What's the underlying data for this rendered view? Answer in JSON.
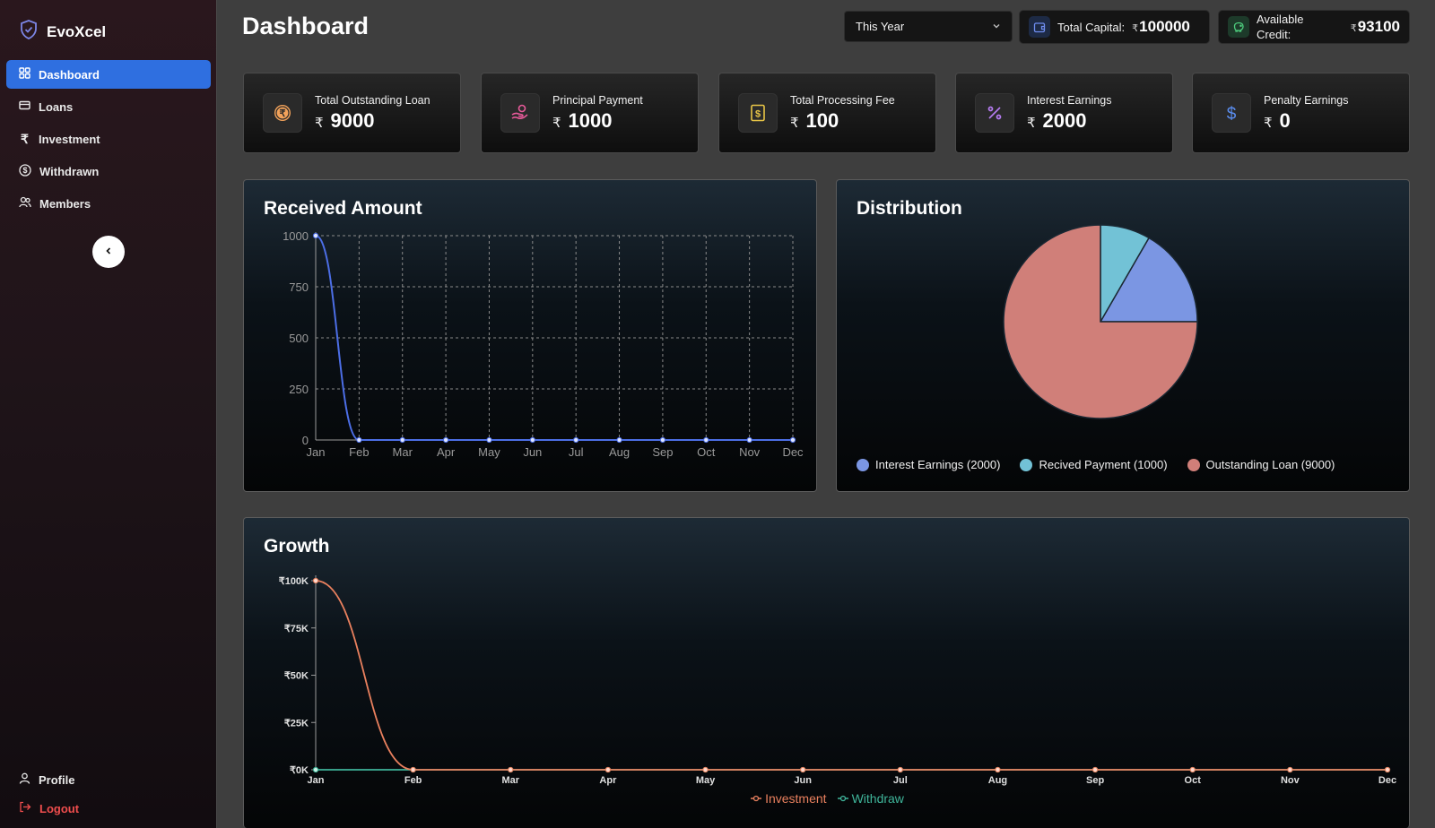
{
  "app": {
    "name": "EvoXcel"
  },
  "sidebar": {
    "items": [
      {
        "label": "Dashboard",
        "icon": "dashboard-grid-icon"
      },
      {
        "label": "Loans",
        "icon": "card-icon"
      },
      {
        "label": "Investment",
        "icon": "rupee-icon"
      },
      {
        "label": "Withdrawn",
        "icon": "dollar-circle-icon"
      },
      {
        "label": "Members",
        "icon": "users-icon"
      }
    ],
    "bottom": [
      {
        "label": "Profile",
        "icon": "user-icon"
      },
      {
        "label": "Logout",
        "icon": "logout-icon"
      }
    ]
  },
  "header": {
    "title": "Dashboard",
    "period": "This Year",
    "total_capital_label": "Total Capital:",
    "total_capital_currency": "₹",
    "total_capital_value": "100000",
    "available_credit_label": "Available Credit:",
    "available_credit_currency": "₹",
    "available_credit_value": "93100"
  },
  "stats": [
    {
      "label": "Total Outstanding Loan",
      "currency": "₹",
      "value": "9000",
      "icon": "rupee-coin-icon"
    },
    {
      "label": "Principal Payment",
      "currency": "₹",
      "value": "1000",
      "icon": "hand-coin-icon"
    },
    {
      "label": "Total Processing Fee",
      "currency": "₹",
      "value": "100",
      "icon": "dollar-bill-icon"
    },
    {
      "label": "Interest Earnings",
      "currency": "₹",
      "value": "2000",
      "icon": "percent-icon"
    },
    {
      "label": "Penalty Earnings",
      "currency": "₹",
      "value": "0",
      "icon": "dollar-icon"
    }
  ],
  "panels": {
    "received_title": "Received Amount",
    "distribution_title": "Distribution",
    "growth_title": "Growth"
  },
  "colors": {
    "accent": "#2f6fe0",
    "received_line": "#4c6ee6",
    "investment": "#e9805e",
    "withdraw": "#3fb59a",
    "pie_interest": "#7b96e3",
    "pie_received": "#72c2d6",
    "pie_outstanding": "#d07f79"
  },
  "chart_data": [
    {
      "type": "line",
      "title": "Received Amount",
      "categories": [
        "Jan",
        "Feb",
        "Mar",
        "Apr",
        "May",
        "Jun",
        "Jul",
        "Aug",
        "Sep",
        "Oct",
        "Nov",
        "Dec"
      ],
      "series": [
        {
          "values": [
            1000,
            0,
            0,
            0,
            0,
            0,
            0,
            0,
            0,
            0,
            0,
            0
          ]
        }
      ],
      "yticks": [
        "0",
        "250",
        "500",
        "750",
        "1000"
      ],
      "ylim": [
        0,
        1000
      ],
      "grid": true
    },
    {
      "type": "pie",
      "title": "Distribution",
      "slices": [
        {
          "label": "Interest Earnings (2000)",
          "value": 2000
        },
        {
          "label": "Recived Payment (1000)",
          "value": 1000
        },
        {
          "label": "Outstanding Loan (9000)",
          "value": 9000
        }
      ],
      "legend": "bottom"
    },
    {
      "type": "line",
      "title": "Growth",
      "categories": [
        "Jan",
        "Feb",
        "Mar",
        "Apr",
        "May",
        "Jun",
        "Jul",
        "Aug",
        "Sep",
        "Oct",
        "Nov",
        "Dec"
      ],
      "series": [
        {
          "name": "Investment",
          "values": [
            100000,
            0,
            0,
            0,
            0,
            0,
            0,
            0,
            0,
            0,
            0,
            0
          ]
        },
        {
          "name": "Withdraw",
          "values": [
            0,
            0,
            0,
            0,
            0,
            0,
            0,
            0,
            0,
            0,
            0,
            0
          ]
        }
      ],
      "yticks": [
        "₹0K",
        "₹25K",
        "₹50K",
        "₹75K",
        "₹100K"
      ],
      "ylim": [
        0,
        100000
      ],
      "grid": false,
      "legend": "bottom"
    }
  ]
}
